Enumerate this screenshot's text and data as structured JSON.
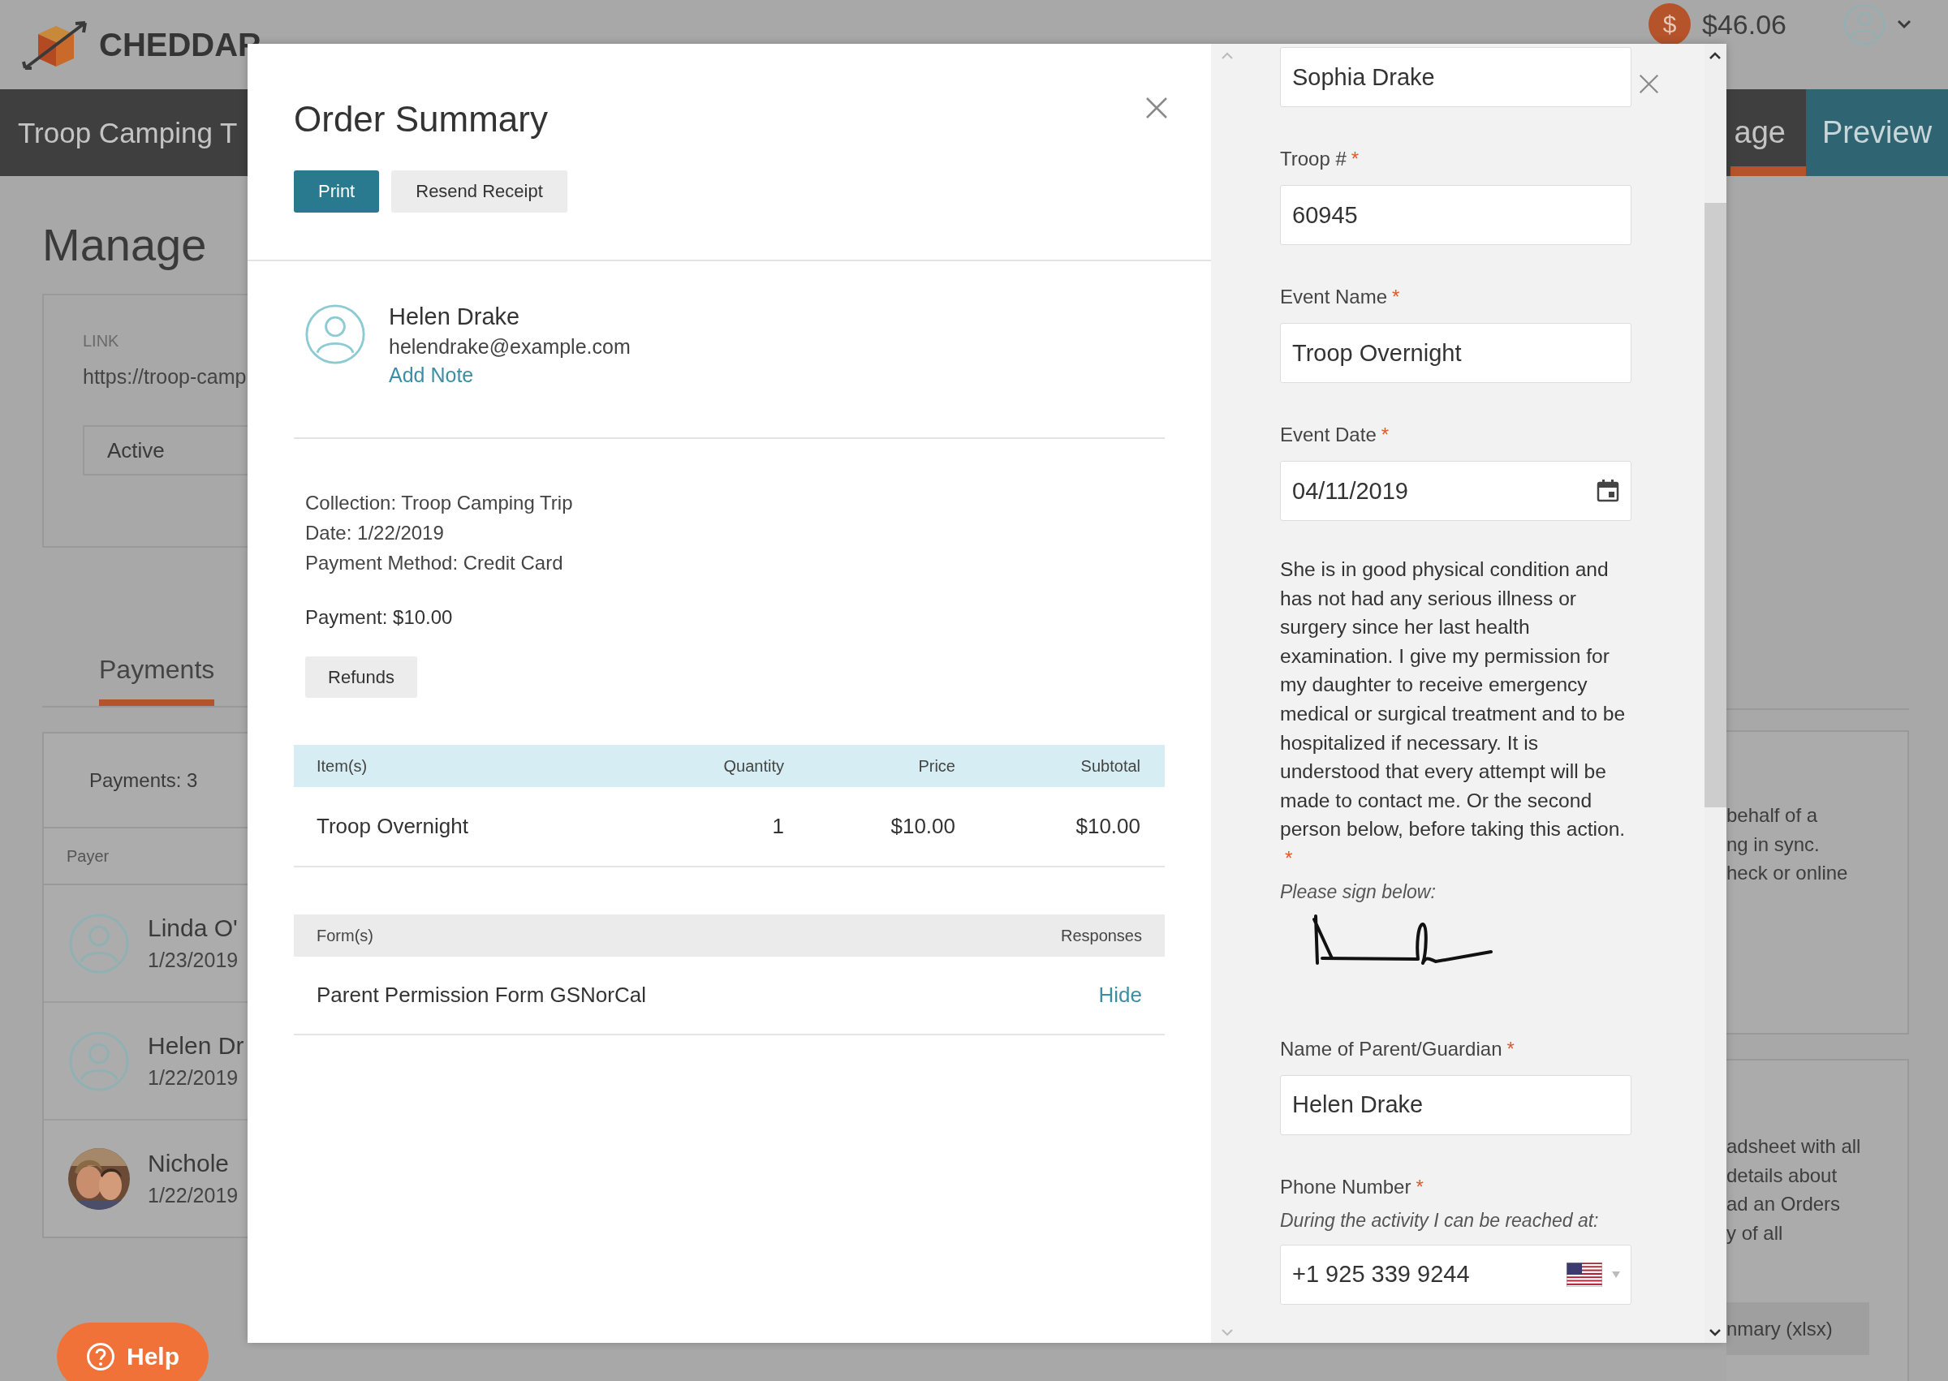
{
  "top_bar": {
    "brand": "CHEDDAR",
    "coin_symbol": "$",
    "balance": "$46.06"
  },
  "collection_bar": {
    "title": "Troop Camping T",
    "tabs": [
      {
        "label": "age",
        "selected": true
      }
    ],
    "preview_button": "Preview"
  },
  "manage": {
    "heading": "Manage",
    "link_label": "LINK",
    "link_url": "https://troop-camp",
    "status": "Active"
  },
  "payments": {
    "tabs": [
      {
        "label": "Payments",
        "selected": true
      }
    ],
    "count": "Payments: 3",
    "column": "Payer",
    "rows": [
      {
        "name": "Linda O'",
        "date": "1/23/2019",
        "kind": "generic"
      },
      {
        "name": "Helen Dr",
        "date": "1/22/2019",
        "kind": "generic"
      },
      {
        "name": "Nichole",
        "date": "1/22/2019"
      }
    ]
  },
  "side_cards": [
    {
      "lines": [
        "behalf of a",
        "ng in sync.",
        "heck or online"
      ]
    },
    {
      "lines": [
        "adsheet with all",
        "details about",
        "ad an Orders",
        "y of all"
      ],
      "button": "nmary (xlsx)"
    }
  ],
  "help_button": "Help",
  "order_summary": {
    "title": "Order Summary",
    "buttons": [
      {
        "label": "Print",
        "kind": "primary"
      },
      {
        "label": "Resend Receipt",
        "kind": "secondary"
      }
    ],
    "payer": {
      "name": "Helen Drake",
      "email": "helendrake@example.com",
      "note_link": "Add Note"
    },
    "details": [
      "Collection: Troop Camping Trip",
      "Date: 1/22/2019",
      "Payment Method: Credit Card"
    ],
    "payment": "Payment: $10.00",
    "refunds_button": "Refunds",
    "items_table": {
      "columns": [
        "Item(s)",
        "Quantity",
        "Price",
        "Subtotal"
      ],
      "rows": [
        [
          "Troop Overnight",
          "1",
          "$10.00",
          "$10.00"
        ]
      ]
    },
    "forms_table": {
      "columns": [
        "Form(s)",
        "Responses"
      ],
      "rows": [
        {
          "name": "Parent Permission Form GSNorCal",
          "action": "Hide"
        }
      ]
    }
  },
  "form_panel": {
    "fields": [
      {
        "kind": "text",
        "value": "Sophia Drake"
      },
      {
        "kind": "text",
        "label": "Troop #",
        "required_mark": "*",
        "value": "60945"
      },
      {
        "kind": "text",
        "label": "Event Name",
        "required_mark": "*",
        "value": "Troop Overnight"
      },
      {
        "kind": "date",
        "label": "Event Date",
        "required_mark": "*",
        "value": "04/11/2019"
      },
      {
        "kind": "consent",
        "text": "She is in good physical condition and has not had any serious illness or surgery since her last health examination. I give my permission for my daughter to receive emergency medical or surgical treatment and to be hospitalized if necessary. It is understood that every attempt will be made to contact me. Or the second person below, before taking this action.",
        "required_mark": "*",
        "hint": "Please sign below:"
      },
      {
        "kind": "text",
        "label": "Name of Parent/Guardian",
        "required_mark": "*",
        "value": "Helen Drake"
      },
      {
        "kind": "phone",
        "label": "Phone Number",
        "required_mark": "*",
        "hint": "During the activity I can be reached at:",
        "value": "+1 925 339 9244"
      }
    ]
  }
}
